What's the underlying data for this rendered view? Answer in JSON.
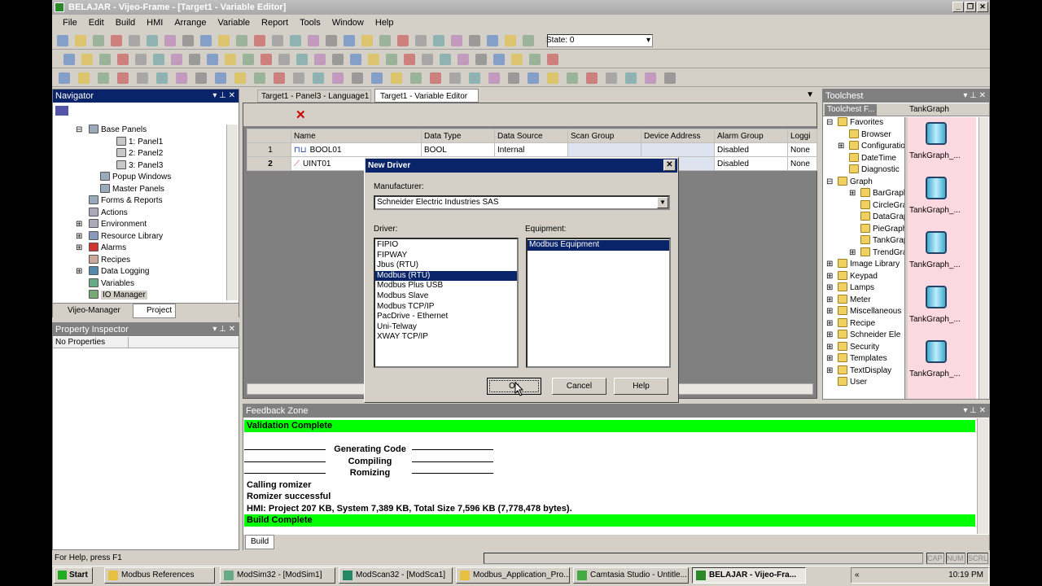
{
  "window": {
    "title": "BELAJAR - Vijeo-Frame - [Target1 - Variable Editor]"
  },
  "menu": [
    "File",
    "Edit",
    "Build",
    "HMI",
    "Arrange",
    "Variable",
    "Report",
    "Tools",
    "Window",
    "Help"
  ],
  "toolbar": {
    "state_label": "State: 0"
  },
  "tabs": [
    "Target1 - Panel3 - Language1",
    "Target1 - Variable Editor"
  ],
  "navigator": {
    "title": "Navigator",
    "tree": [
      {
        "label": "Base Panels",
        "indent": 44,
        "exp": "⊟"
      },
      {
        "label": "1: Panel1",
        "indent": 78
      },
      {
        "label": "2: Panel2",
        "indent": 78
      },
      {
        "label": "3: Panel3",
        "indent": 78
      },
      {
        "label": "Popup Windows",
        "indent": 58
      },
      {
        "label": "Master Panels",
        "indent": 58
      },
      {
        "label": "Forms & Reports",
        "indent": 44
      },
      {
        "label": "Actions",
        "indent": 44
      },
      {
        "label": "Environment",
        "indent": 44,
        "exp": "⊞"
      },
      {
        "label": "Resource Library",
        "indent": 44,
        "exp": "⊞"
      },
      {
        "label": "Alarms",
        "indent": 44,
        "exp": "⊞"
      },
      {
        "label": "Recipes",
        "indent": 44
      },
      {
        "label": "Data Logging",
        "indent": 44,
        "exp": "⊞"
      },
      {
        "label": "Variables",
        "indent": 44
      },
      {
        "label": "IO Manager",
        "indent": 44,
        "selected": true
      }
    ],
    "bottom_tabs": [
      "Vijeo-Manager",
      "Project"
    ]
  },
  "property": {
    "title": "Property Inspector",
    "text": "No Properties"
  },
  "variable_grid": {
    "headers": [
      "Name",
      "Data Type",
      "Data Source",
      "Scan Group",
      "Device Address",
      "Alarm Group",
      "Loggi"
    ],
    "rows": [
      {
        "num": "1",
        "name": "BOOL01",
        "type": "BOOL",
        "source": "Internal",
        "scan": "",
        "device": "",
        "alarm": "Disabled",
        "log": "None"
      },
      {
        "num": "2",
        "name": "UINT01",
        "type": "",
        "source": "",
        "scan": "",
        "device": "",
        "alarm": "Disabled",
        "log": "None"
      }
    ]
  },
  "dialog": {
    "title": "New Driver",
    "manufacturer_label": "Manufacturer:",
    "manufacturer_value": "Schneider Electric Industries SAS",
    "driver_label": "Driver:",
    "equipment_label": "Equipment:",
    "drivers": [
      "FIPIO",
      "FIPWAY",
      "Jbus (RTU)",
      "Modbus (RTU)",
      "Modbus Plus USB",
      "Modbus Slave",
      "Modbus TCP/IP",
      "PacDrive - Ethernet",
      "Uni-Telway",
      "XWAY TCP/IP"
    ],
    "selected_driver": "Modbus (RTU)",
    "equipment": [
      "Modbus Equipment"
    ],
    "ok": "Ok",
    "cancel": "Cancel",
    "help": "Help"
  },
  "toolchest": {
    "title": "Toolchest",
    "left_tab": "Toolchest F...",
    "right_tab": "TankGraph",
    "tree": [
      {
        "label": "Favorites",
        "indent": 4,
        "exp": "⊟"
      },
      {
        "label": "Browser",
        "indent": 18
      },
      {
        "label": "Configuration",
        "indent": 18,
        "exp": "⊞"
      },
      {
        "label": "DateTime",
        "indent": 18
      },
      {
        "label": "Diagnostic",
        "indent": 18
      },
      {
        "label": "Graph",
        "indent": 4,
        "exp": "⊟"
      },
      {
        "label": "BarGraph",
        "indent": 32,
        "exp": "⊞"
      },
      {
        "label": "CircleGrap",
        "indent": 32
      },
      {
        "label": "DataGrap",
        "indent": 32
      },
      {
        "label": "PieGraph",
        "indent": 32
      },
      {
        "label": "TankGrap",
        "indent": 32
      },
      {
        "label": "TrendGra",
        "indent": 32,
        "exp": "⊞"
      },
      {
        "label": "Image Library",
        "indent": 4,
        "exp": "⊞"
      },
      {
        "label": "Keypad",
        "indent": 4,
        "exp": "⊞"
      },
      {
        "label": "Lamps",
        "indent": 4,
        "exp": "⊞"
      },
      {
        "label": "Meter",
        "indent": 4,
        "exp": "⊞"
      },
      {
        "label": "Miscellaneous",
        "indent": 4,
        "exp": "⊞"
      },
      {
        "label": "Recipe",
        "indent": 4,
        "exp": "⊞"
      },
      {
        "label": "Schneider Ele",
        "indent": 4,
        "exp": "⊞"
      },
      {
        "label": "Security",
        "indent": 4,
        "exp": "⊞"
      },
      {
        "label": "Templates",
        "indent": 4,
        "exp": "⊞"
      },
      {
        "label": "TextDisplay",
        "indent": 4,
        "exp": "⊞"
      },
      {
        "label": "User",
        "indent": 4
      }
    ],
    "items": [
      "TankGraph_...",
      "TankGraph_...",
      "TankGraph_...",
      "TankGraph_...",
      "TankGraph_..."
    ]
  },
  "feedback": {
    "title": "Feedback Zone",
    "lines": [
      {
        "text": "Validation Complete",
        "green": true
      },
      {
        "text": ""
      },
      {
        "text": "Generating Code",
        "center": true
      },
      {
        "text": "Compiling",
        "center": true
      },
      {
        "text": "Romizing",
        "center": true
      },
      {
        "text": "Calling romizer"
      },
      {
        "text": "Romizer successful"
      },
      {
        "text": "HMI: Project 207 KB, System 7,389 KB, Total Size 7,596 KB (7,778,478 bytes)."
      },
      {
        "text": "Build Complete",
        "green": true
      }
    ],
    "tab": "Build"
  },
  "status": {
    "help": "For Help, press F1",
    "indicators": [
      "CAP",
      "NUM",
      "SCRL"
    ]
  },
  "taskbar": {
    "start": "Start",
    "tasks": [
      "Modbus References",
      "ModSim32 - [ModSim1]",
      "ModScan32 - [ModSca1]",
      "Modbus_Application_Pro...",
      "Camtasia Studio - Untitle...",
      "BELAJAR - Vijeo-Fra..."
    ],
    "clock": "10:19 PM"
  }
}
